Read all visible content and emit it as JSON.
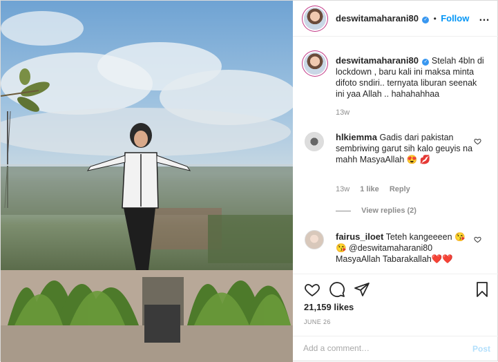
{
  "header": {
    "username": "deswitamaharani80",
    "separator": "•",
    "follow_label": "Follow",
    "more_label": "…"
  },
  "caption": {
    "username": "deswitamaharani80",
    "text": "Stelah 4bln di lockdown , baru kali ini maksa minta difoto sndiri.. ternyata liburan seenak ini yaa Allah .. hahahahhaa",
    "time": "13w"
  },
  "comments": [
    {
      "username": "hlkiemma",
      "text": "Gadis dari pakistan sembriwing garut sih kalo geuyis na mahh MasyaAllah 😍 💋",
      "time": "13w",
      "likes": "1 like",
      "reply_label": "Reply",
      "view_replies": "View replies (2)"
    },
    {
      "username": "fairus_iloet",
      "text": "Teteh kangeeeen 😘 😘 @deswitamaharani80 MasyaAllah Tabarakallah❤️❤️"
    }
  ],
  "actions": {
    "likes": "21,159 likes",
    "date": "JUNE 26"
  },
  "add_comment": {
    "placeholder": "Add a comment…",
    "post_label": "Post"
  },
  "icons": [
    "heart-icon",
    "comment-icon",
    "share-icon",
    "bookmark-icon",
    "verified-icon",
    "more-icon"
  ],
  "colors": {
    "link": "#0095f6",
    "verified": "#3897f0",
    "muted": "#8e8e8e",
    "post_disabled": "#b2dffc"
  }
}
